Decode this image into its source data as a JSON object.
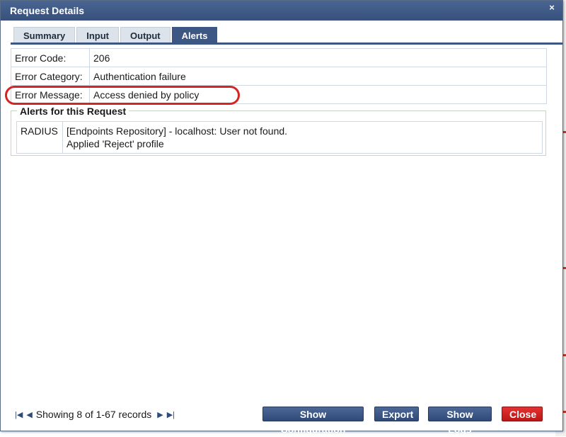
{
  "dialog": {
    "title": "Request Details",
    "close_glyph": "×"
  },
  "tabs": [
    {
      "label": "Summary",
      "active": false
    },
    {
      "label": "Input",
      "active": false
    },
    {
      "label": "Output",
      "active": false
    },
    {
      "label": "Alerts",
      "active": true
    }
  ],
  "details": [
    {
      "label": "Error Code:",
      "value": "206"
    },
    {
      "label": "Error Category:",
      "value": "Authentication failure"
    },
    {
      "label": "Error Message:",
      "value": "Access denied by policy"
    }
  ],
  "alerts_section": {
    "title": "Alerts for this Request",
    "rows": [
      {
        "source": "RADIUS",
        "line1": "[Endpoints Repository] - localhost: User not found.",
        "line2": "Applied 'Reject' profile"
      }
    ]
  },
  "pager": {
    "text": "Showing 8 of 1-67 records",
    "first_icon": "first-page-icon",
    "prev_icon": "prev-page-icon",
    "next_icon": "next-page-icon",
    "last_icon": "last-page-icon"
  },
  "buttons": {
    "show_configuration": "Show Configuration",
    "export": "Export",
    "show_logs": "Show Logs",
    "close": "Close"
  },
  "colors": {
    "titlebar": "#3d5785",
    "active_tab": "#3d5785",
    "close_button": "#d42424",
    "highlight": "#d42424"
  }
}
